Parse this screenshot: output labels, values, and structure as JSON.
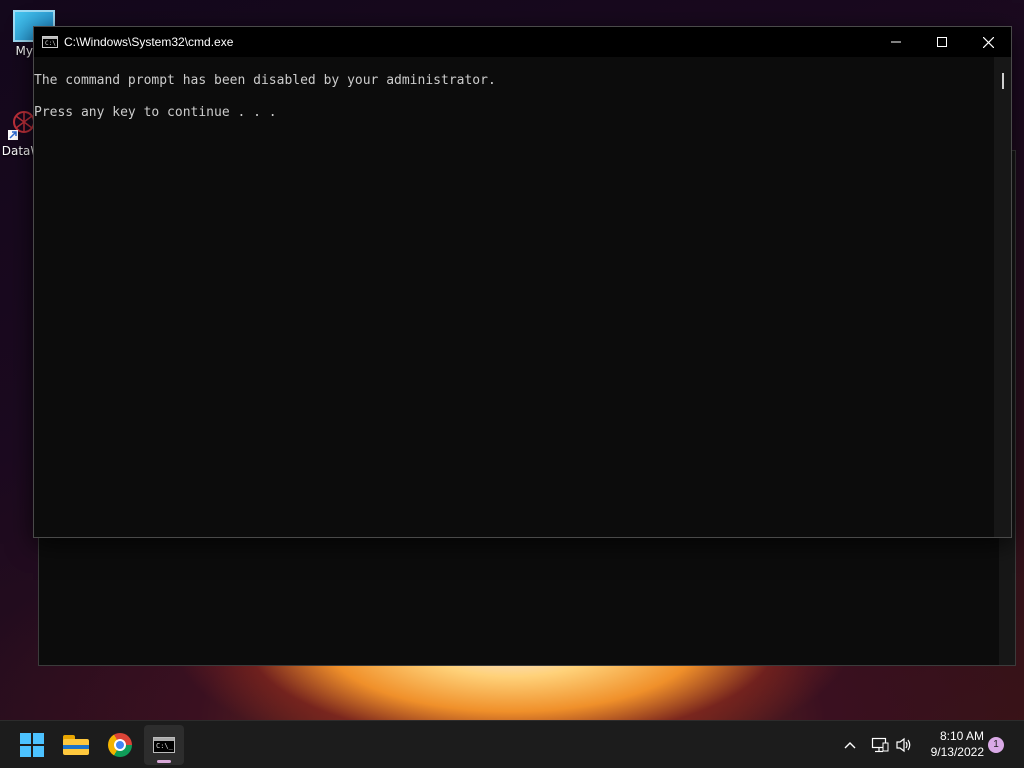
{
  "desktop": {
    "icons": [
      {
        "label": "My Co",
        "icon": "computer-icon"
      },
      {
        "label": "DataW",
        "icon": "datawarrior-icon"
      }
    ]
  },
  "cmd_window": {
    "title": "C:\\Windows\\System32\\cmd.exe",
    "console_lines": [
      "The command prompt has been disabled by your administrator.",
      "Press any key to continue . . ."
    ],
    "buttons": {
      "minimize": "minimize-icon",
      "maximize": "maximize-icon",
      "close": "close-icon"
    }
  },
  "taskbar": {
    "items": [
      {
        "name": "start",
        "icon": "windows-logo-icon"
      },
      {
        "name": "file-explorer",
        "icon": "folder-icon"
      },
      {
        "name": "chrome",
        "icon": "chrome-icon"
      },
      {
        "name": "command-prompt",
        "icon": "cmd-icon",
        "active": true
      }
    ],
    "tray": {
      "time": "8:10 AM",
      "date": "9/13/2022",
      "notification_count": "1"
    }
  },
  "colors": {
    "console_bg": "#0c0c0c",
    "console_text": "#cccccc",
    "taskbar_bg": "#1c1c1c",
    "badge": "#d9a9e6"
  }
}
